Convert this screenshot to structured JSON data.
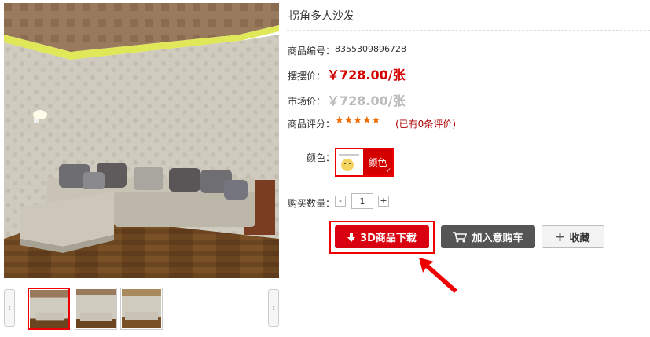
{
  "product": {
    "title": "拐角多人沙发",
    "code_label": "商品编号：",
    "code_value": "8355309896728",
    "price_label": "摆摆价：",
    "price_value": "￥728.00/张",
    "market_label": "市场价：",
    "market_value": "￥728.00/张",
    "rating_label": "商品评分：",
    "rating_stars": "★★★★★",
    "rating_value": 5,
    "review_text": "(已有0条评价)",
    "color_label": "颜色：",
    "color_option": "颜色",
    "qty_label": "购买数量：",
    "qty_minus": "-",
    "qty_plus": "+",
    "qty_value": "1"
  },
  "actions": {
    "download_label": "3D商品下载",
    "cart_label": "加入意购车",
    "favorite_label": "收藏"
  },
  "gallery": {
    "prev": "‹",
    "next": "›",
    "thumb_count": 3,
    "active_index": 0
  },
  "icons": {
    "download": "down-arrow-icon",
    "cart": "cart-icon",
    "favorite": "plus-icon",
    "annotation": "red-pointer-arrow-icon"
  },
  "colors": {
    "accent": "#d9000f",
    "price": "#d40000",
    "stars": "#f06c00",
    "dark_button": "#555555"
  }
}
